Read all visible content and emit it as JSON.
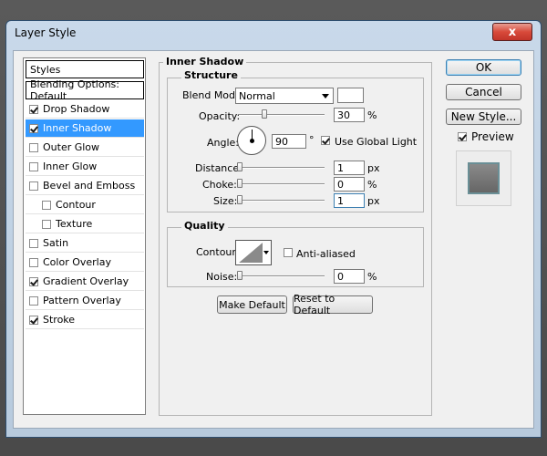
{
  "window": {
    "title": "Layer Style"
  },
  "styles_list": {
    "header": "Styles",
    "blending": "Blending Options: Default",
    "items": [
      {
        "label": "Drop Shadow",
        "checked": true
      },
      {
        "label": "Inner Shadow",
        "checked": true,
        "selected": true
      },
      {
        "label": "Outer Glow",
        "checked": false
      },
      {
        "label": "Inner Glow",
        "checked": false
      },
      {
        "label": "Bevel and Emboss",
        "checked": false
      },
      {
        "label": "Contour",
        "checked": false
      },
      {
        "label": "Texture",
        "checked": false
      },
      {
        "label": "Satin",
        "checked": false
      },
      {
        "label": "Color Overlay",
        "checked": false
      },
      {
        "label": "Gradient Overlay",
        "checked": true
      },
      {
        "label": "Pattern Overlay",
        "checked": false
      },
      {
        "label": "Stroke",
        "checked": true
      }
    ]
  },
  "panel": {
    "title": "Inner Shadow",
    "structure": {
      "legend": "Structure",
      "blend_mode_label": "Blend Mode:",
      "blend_mode_value": "Normal",
      "opacity_label": "Opacity:",
      "opacity_value": "30",
      "opacity_unit": "%",
      "opacity_level": 0.3,
      "angle_label": "Angle:",
      "angle_value": "90",
      "angle_unit": "°",
      "use_global_light": "Use Global Light",
      "distance_label": "Distance:",
      "distance_value": "1",
      "distance_unit": "px",
      "choke_label": "Choke:",
      "choke_value": "0",
      "choke_unit": "%",
      "size_label": "Size:",
      "size_value": "1",
      "size_unit": "px"
    },
    "quality": {
      "legend": "Quality",
      "contour_label": "Contour:",
      "anti_aliased": "Anti-aliased",
      "noise_label": "Noise:",
      "noise_value": "0",
      "noise_unit": "%"
    },
    "make_default": "Make Default",
    "reset_default": "Reset to Default"
  },
  "buttons": {
    "ok": "OK",
    "cancel": "Cancel",
    "new_style": "New Style...",
    "preview": "Preview",
    "close": "x"
  }
}
